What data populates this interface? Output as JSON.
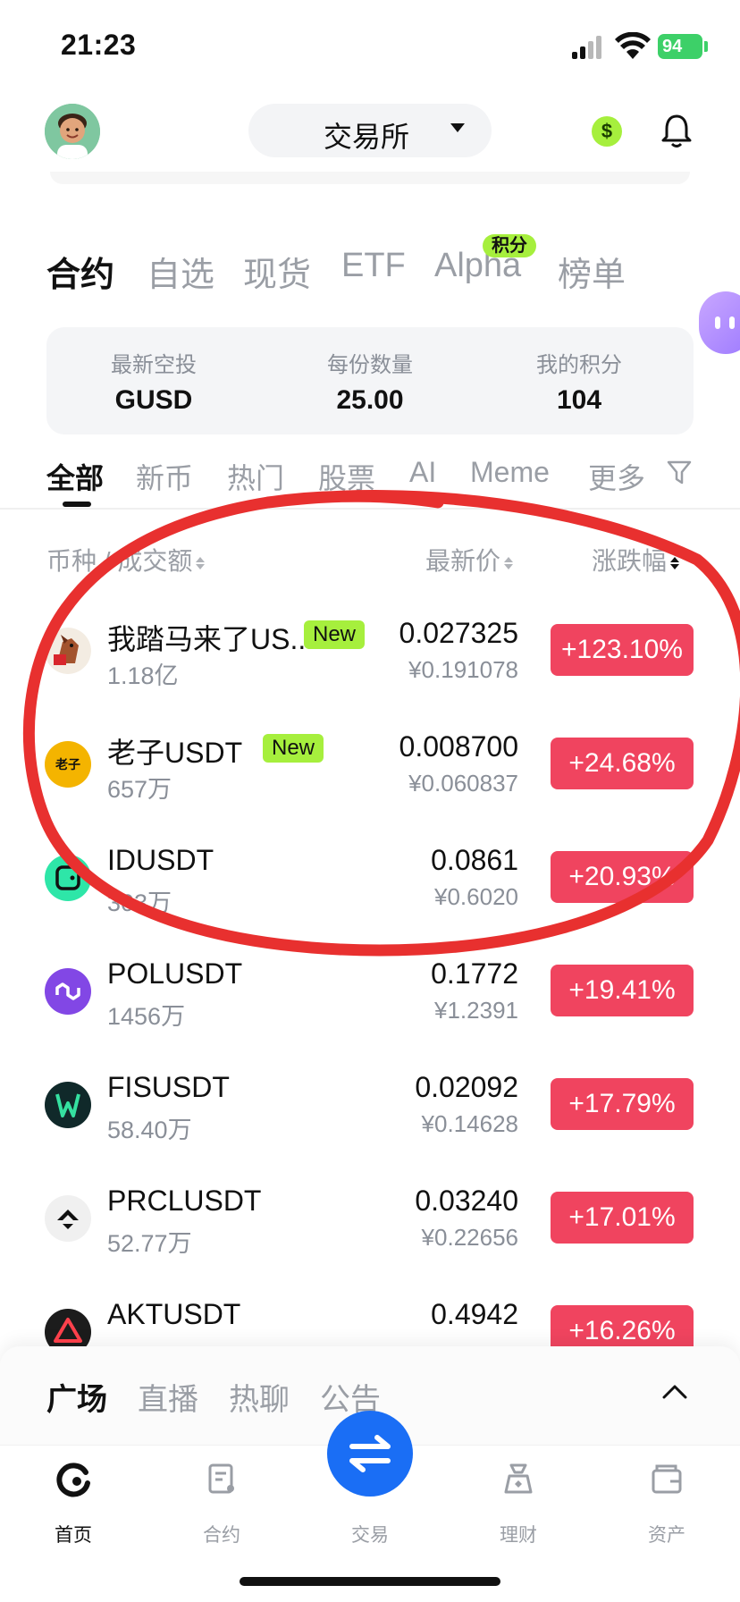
{
  "status_bar": {
    "time": "21:23",
    "battery": "94"
  },
  "header": {
    "exchange_label": "交易所",
    "coin_symbol": "$"
  },
  "category_tabs": [
    {
      "label": "合约",
      "active": true
    },
    {
      "label": "自选"
    },
    {
      "label": "现货"
    },
    {
      "label": "ETF"
    },
    {
      "label": "Alpha",
      "badge": "积分"
    },
    {
      "label": "榜单"
    }
  ],
  "airdrop": {
    "latest_label": "最新空投",
    "latest_value": "GUSD",
    "per_share_label": "每份数量",
    "per_share_value": "25.00",
    "points_label": "我的积分",
    "points_value": "104"
  },
  "filter_tabs": [
    {
      "label": "全部",
      "active": true
    },
    {
      "label": "新币"
    },
    {
      "label": "热门"
    },
    {
      "label": "股票"
    },
    {
      "label": "AI"
    },
    {
      "label": "Meme"
    },
    {
      "label": "更多"
    }
  ],
  "columns": {
    "coin_volume": "币种 / 成交额",
    "latest_price": "最新价",
    "change": "涨跌幅"
  },
  "rows": [
    {
      "name": "我踏马来了US...",
      "badge": "New",
      "volume": "1.18亿",
      "price": "0.027325",
      "cny": "¥0.191078",
      "change": "+123.10%"
    },
    {
      "name": "老子USDT",
      "badge": "New",
      "volume": "657万",
      "price": "0.008700",
      "cny": "¥0.060837",
      "change": "+24.68%",
      "icon_text": "老子"
    },
    {
      "name": "IDUSDT",
      "volume": "303万",
      "price": "0.0861",
      "cny": "¥0.6020",
      "change": "+20.93%"
    },
    {
      "name": "POLUSDT",
      "volume": "1456万",
      "price": "0.1772",
      "cny": "¥1.2391",
      "change": "+19.41%"
    },
    {
      "name": "FISUSDT",
      "volume": "58.40万",
      "price": "0.02092",
      "cny": "¥0.14628",
      "change": "+17.79%"
    },
    {
      "name": "PRCLUSDT",
      "volume": "52.77万",
      "price": "0.03240",
      "cny": "¥0.22656",
      "change": "+17.01%"
    },
    {
      "name": "AKTUSDT",
      "price": "0.4942",
      "change": "+16.26%"
    }
  ],
  "community_tabs": [
    {
      "label": "广场",
      "active": true
    },
    {
      "label": "直播"
    },
    {
      "label": "热聊"
    },
    {
      "label": "公告"
    }
  ],
  "nav": [
    {
      "label": "首页",
      "icon": "home-icon",
      "active": true
    },
    {
      "label": "合约",
      "icon": "contract-icon"
    },
    {
      "label": "交易",
      "icon": "trade-icon"
    },
    {
      "label": "理财",
      "icon": "wealth-icon"
    },
    {
      "label": "资产",
      "icon": "assets-icon"
    }
  ],
  "colors": {
    "up": "#f0445f",
    "badge": "#a6ef3d",
    "primary": "#1a6ef5",
    "annotation": "#e8302f"
  }
}
